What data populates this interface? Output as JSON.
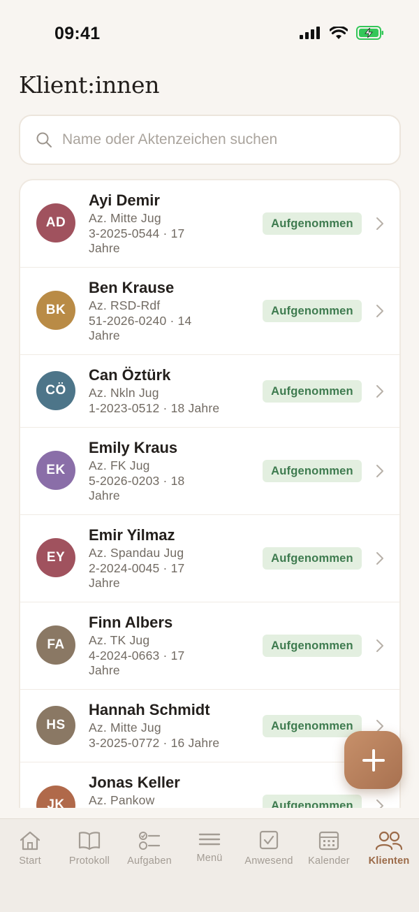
{
  "status_bar": {
    "time": "09:41"
  },
  "title": "Klient:innen",
  "search": {
    "placeholder": "Name oder Aktenzeichen suchen",
    "value": ""
  },
  "clients": [
    {
      "initials": "AD",
      "name": "Ayi Demir",
      "meta_lines": [
        "Az. Mitte Jug",
        "3-2025-0544 · 17",
        "Jahre"
      ],
      "status": "Aufgenommen",
      "color": "#a0525e"
    },
    {
      "initials": "BK",
      "name": "Ben Krause",
      "meta_lines": [
        "Az. RSD-Rdf",
        "51-2026-0240 · 14",
        "Jahre"
      ],
      "status": "Aufgenommen",
      "color": "#b98b46"
    },
    {
      "initials": "CÖ",
      "name": "Can Öztürk",
      "meta_lines": [
        "Az. Nkln Jug",
        "1-2023-0512 · 18 Jahre"
      ],
      "status": "Aufgenommen",
      "color": "#4d7589"
    },
    {
      "initials": "EK",
      "name": "Emily Kraus",
      "meta_lines": [
        "Az. FK Jug",
        "5-2026-0203 · 18",
        "Jahre"
      ],
      "status": "Aufgenommen",
      "color": "#8a6ea8"
    },
    {
      "initials": "EY",
      "name": "Emir Yilmaz",
      "meta_lines": [
        "Az. Spandau Jug",
        "2-2024-0045 · 17",
        "Jahre"
      ],
      "status": "Aufgenommen",
      "color": "#a0525e"
    },
    {
      "initials": "FA",
      "name": "Finn Albers",
      "meta_lines": [
        "Az. TK Jug",
        "4-2024-0663 · 17",
        "Jahre"
      ],
      "status": "Aufgenommen",
      "color": "#8a7864"
    },
    {
      "initials": "HS",
      "name": "Hannah Schmidt",
      "meta_lines": [
        "Az. Mitte Jug",
        "3-2025-0772 · 16 Jahre"
      ],
      "status": "Aufgenommen",
      "color": "#8a7864"
    },
    {
      "initials": "JK",
      "name": "Jonas Keller",
      "meta_lines": [
        "Az. Pankow"
      ],
      "status": "Aufgenommen",
      "color": "#b0694a"
    }
  ],
  "nav": [
    {
      "label": "Start",
      "icon": "home-icon",
      "active": false
    },
    {
      "label": "Protokoll",
      "icon": "book-icon",
      "active": false
    },
    {
      "label": "Aufgaben",
      "icon": "checklist-icon",
      "active": false
    },
    {
      "label": "Menü",
      "icon": "menu-icon",
      "active": false
    },
    {
      "label": "Anwesend",
      "icon": "checkbox-icon",
      "active": false
    },
    {
      "label": "Kalender",
      "icon": "calendar-icon",
      "active": false
    },
    {
      "label": "Klienten",
      "icon": "people-icon",
      "active": true
    }
  ],
  "colors": {
    "background": "#f8f5f1",
    "badge_bg": "#e3efe0",
    "badge_text": "#3e7b4f",
    "accent": "#9b6a48",
    "fab": "#b57d58"
  }
}
